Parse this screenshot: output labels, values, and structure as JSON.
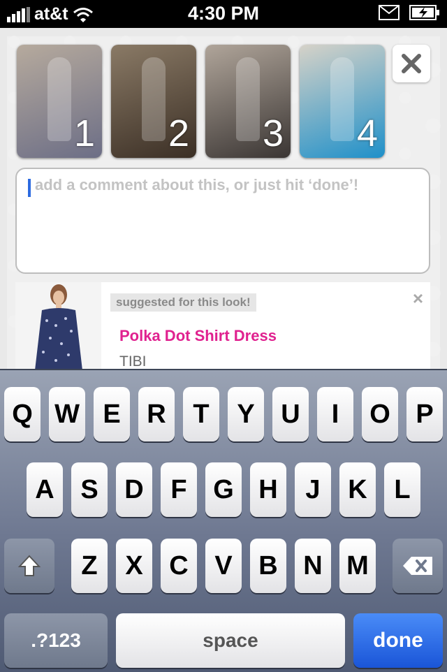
{
  "status_bar": {
    "carrier": "at&t",
    "time": "4:30 PM",
    "signal_icon": "signal-bars-icon",
    "wifi_icon": "wifi-icon",
    "mail_icon": "mail-icon",
    "battery_icon": "battery-charging-icon"
  },
  "photos": [
    {
      "label": "1",
      "colors": [
        "#b6aa9d",
        "#6c6e86"
      ]
    },
    {
      "label": "2",
      "colors": [
        "#8a7a66",
        "#3b2f25"
      ]
    },
    {
      "label": "3",
      "colors": [
        "#b0a59a",
        "#3a3533"
      ]
    },
    {
      "label": "4",
      "colors": [
        "#d6d2c8",
        "#1f90c9"
      ]
    }
  ],
  "close_icon": "close-icon",
  "comment": {
    "placeholder": "add a comment about this, or just hit ‘done’!",
    "value": ""
  },
  "suggestion": {
    "tag": "suggested for this look!",
    "title": "Polka Dot Shirt Dress",
    "brand": "TIBI",
    "dismiss_label": "×"
  },
  "keyboard": {
    "row1": [
      "Q",
      "W",
      "E",
      "R",
      "T",
      "Y",
      "U",
      "I",
      "O",
      "P"
    ],
    "row2": [
      "A",
      "S",
      "D",
      "F",
      "G",
      "H",
      "J",
      "K",
      "L"
    ],
    "row3": [
      "Z",
      "X",
      "C",
      "V",
      "B",
      "N",
      "M"
    ],
    "shift_icon": "shift-arrow-icon",
    "delete_icon": "backspace-icon",
    "numbers_label": ".?123",
    "space_label": "space",
    "done_label": "done"
  },
  "colors": {
    "accent_pink": "#e0218f",
    "done_blue": "#1a55d8",
    "caret_blue": "#2d6be0"
  }
}
